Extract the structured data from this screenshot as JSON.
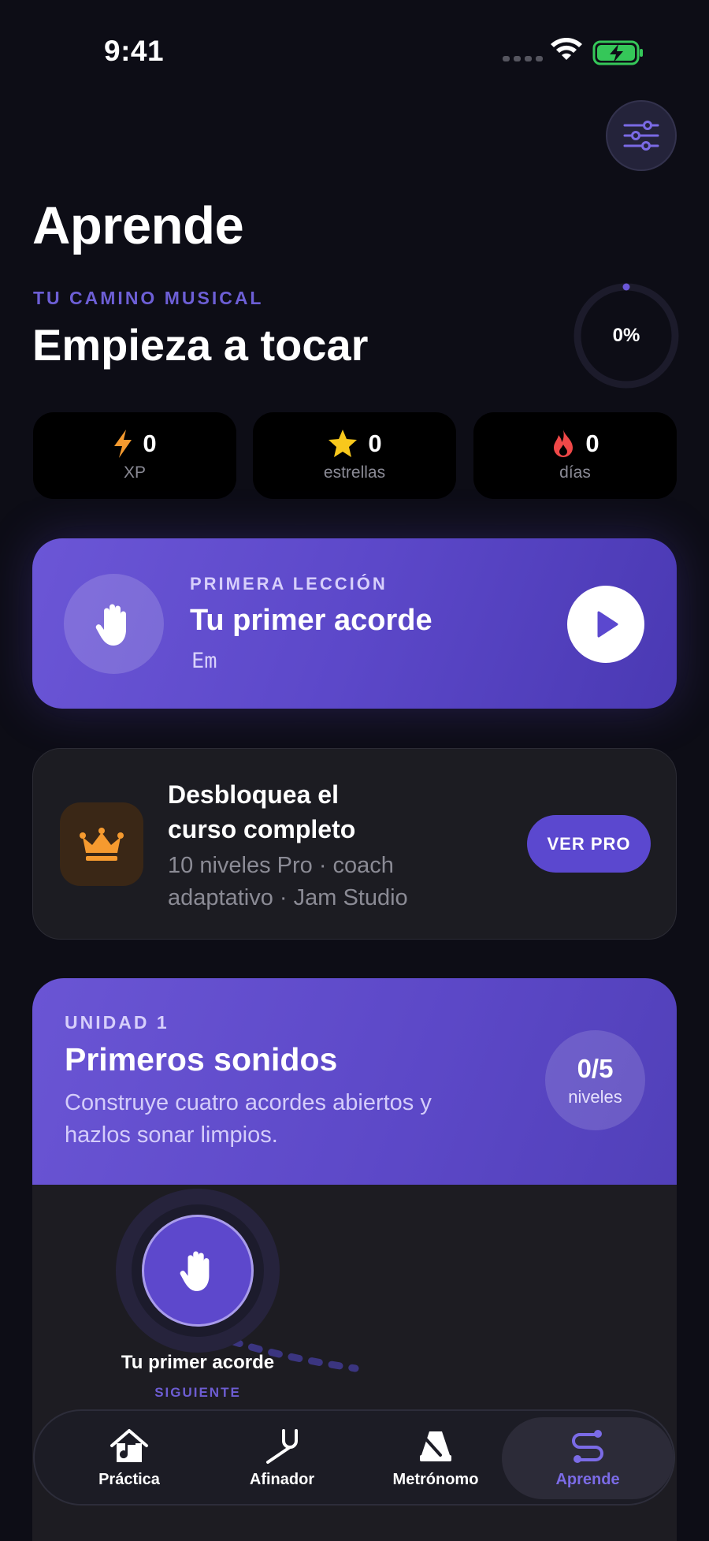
{
  "status_bar": {
    "time": "9:41"
  },
  "header": {
    "title": "Aprende",
    "eyebrow": "TU CAMINO MUSICAL",
    "subtitle": "Empieza a tocar",
    "progress_label": "0%",
    "progress": 0
  },
  "stats": [
    {
      "value": "0",
      "label": "XP",
      "icon": "bolt-icon",
      "color": "#f59a2f"
    },
    {
      "value": "0",
      "label": "estrellas",
      "icon": "star-icon",
      "color": "#f8c81c"
    },
    {
      "value": "0",
      "label": "días",
      "icon": "flame-icon",
      "color": "#f04848"
    }
  ],
  "lesson": {
    "eyebrow": "PRIMERA LECCIÓN",
    "title": "Tu primer acorde",
    "chord": "Em"
  },
  "pro": {
    "title": "Desbloquea el curso completo",
    "subtitle": "10 niveles Pro · coach adaptativo · Jam Studio",
    "button": "VER PRO"
  },
  "unit": {
    "eyebrow": "UNIDAD 1",
    "title": "Primeros sonidos",
    "description": "Construye cuatro acordes abiertos y hazlos sonar limpios.",
    "badge_value": "0/5",
    "badge_label": "niveles",
    "node": {
      "title": "Tu primer acorde",
      "tag": "SIGUIENTE"
    }
  },
  "tabs": [
    {
      "label": "Práctica",
      "icon": "home-music-icon"
    },
    {
      "label": "Afinador",
      "icon": "tuning-fork-icon"
    },
    {
      "label": "Metrónomo",
      "icon": "metronome-icon"
    },
    {
      "label": "Aprende",
      "icon": "path-icon",
      "active": true
    }
  ],
  "colors": {
    "accent": "#5b48cf",
    "background": "#0d0d16",
    "battery": "#35c759"
  }
}
